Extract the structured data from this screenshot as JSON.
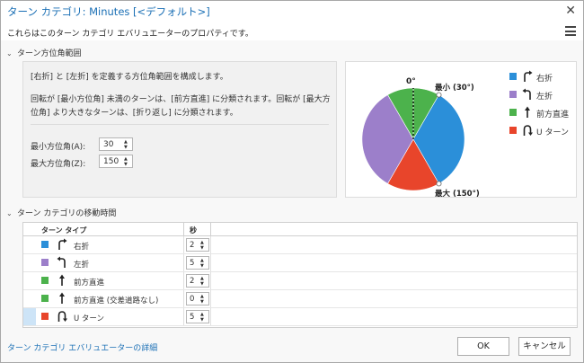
{
  "window": {
    "title": "ターン カテゴリ: Minutes [<デフォルト>]",
    "subtitle": "これらはこのターン カテゴリ エバリュエーターのプロパティです。"
  },
  "angle_section": {
    "header": "ターン方位角範囲",
    "description1": "[右折] と [左折] を定義する方位角範囲を構成します。",
    "description2": "回転が [最小方位角] 未満のターンは、[前方直進] に分類されます。回転が [最大方位角] より大きなターンは、[折り返し] に分類されます。",
    "min_label": "最小方位角(A):",
    "min_value": "30",
    "max_label": "最大方位角(Z):",
    "max_value": "150",
    "diagram": {
      "label_zero": "0°",
      "label_min": "最小 (30°)",
      "label_max": "最大 (150°)"
    },
    "legend": [
      {
        "label": "右折",
        "color": "#2b8fd9",
        "icon": "turn-right-icon"
      },
      {
        "label": "左折",
        "color": "#9c7fca",
        "icon": "turn-left-icon"
      },
      {
        "label": "前方直進",
        "color": "#4cb24c",
        "icon": "straight-arrow-icon"
      },
      {
        "label": "U ターン",
        "color": "#e8452b",
        "icon": "u-turn-icon"
      }
    ]
  },
  "travel_section": {
    "header": "ターン カテゴリの移動時間",
    "columns": {
      "type": "ターン タイプ",
      "seconds": "秒"
    },
    "rows": [
      {
        "label": "右折",
        "value": "2",
        "color": "#2b8fd9",
        "icon": "turn-right-icon"
      },
      {
        "label": "左折",
        "value": "5",
        "color": "#9c7fca",
        "icon": "turn-left-icon"
      },
      {
        "label": "前方直進",
        "value": "2",
        "color": "#4cb24c",
        "icon": "straight-arrow-icon"
      },
      {
        "label": "前方直進 (交差道路なし)",
        "value": "0",
        "color": "#4cb24c",
        "icon": "straight-arrow-icon"
      },
      {
        "label": "U ターン",
        "value": "5",
        "color": "#e8452b",
        "icon": "u-turn-icon"
      }
    ]
  },
  "footer": {
    "link": "ターン カテゴリ エバリュエーターの詳細",
    "ok": "OK",
    "cancel": "キャンセル"
  },
  "colors": {
    "accent": "#1a6fb5",
    "right_turn": "#2b8fd9",
    "left_turn": "#9c7fca",
    "straight": "#4cb24c",
    "u_turn": "#e8452b"
  }
}
